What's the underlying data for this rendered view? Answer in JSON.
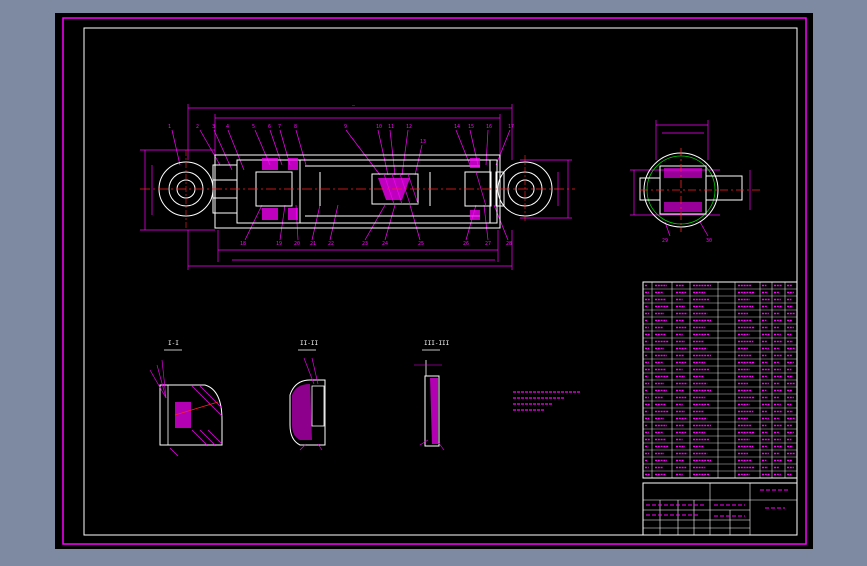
{
  "viewport": {
    "title": "",
    "background": "#7e8aa2"
  },
  "colors": {
    "sheet": "#000000",
    "border": "#ff00ff",
    "outline": "#ffffff",
    "centerline": "#ff2222",
    "dimension": "#ff00ff",
    "hatch": "#ff00ff",
    "annotation": "#ff00ff",
    "accent_green": "#00d000"
  },
  "section_labels": [
    "I-I",
    "II-II",
    "III-III"
  ],
  "notes_text": [
    "",
    "",
    ""
  ],
  "bom_rows": 28,
  "title_block": {
    "name": "",
    "drawing_no": ""
  }
}
